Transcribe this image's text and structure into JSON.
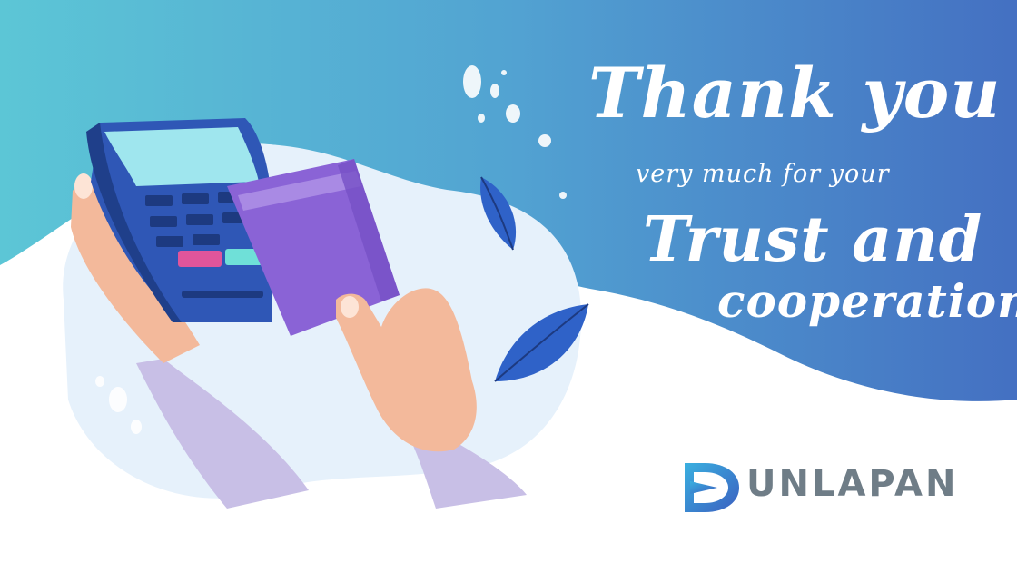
{
  "card": {
    "headline_line1": "Thank you",
    "headline_line2": "very much for your",
    "headline_line3": "Trust and",
    "headline_line4": "cooperation"
  },
  "brand": {
    "name": "UNLAPAN",
    "logo_colors": [
      "#3ab0e0",
      "#3b5fc0"
    ]
  },
  "colors": {
    "gradient_start": "#5cc6d6",
    "gradient_end": "#4470c2",
    "blob": "#e6f1fb",
    "terminal": "#2f57b6",
    "screen": "#9fe6ee",
    "card": "#8a63d6",
    "leaf": "#2f62c8",
    "skin": "#f3b99b",
    "sleeve": "#c8bfe6"
  },
  "icons": [
    "card-terminal-illustration",
    "credit-card-illustration",
    "leaf-icon",
    "brand-logo-icon"
  ]
}
